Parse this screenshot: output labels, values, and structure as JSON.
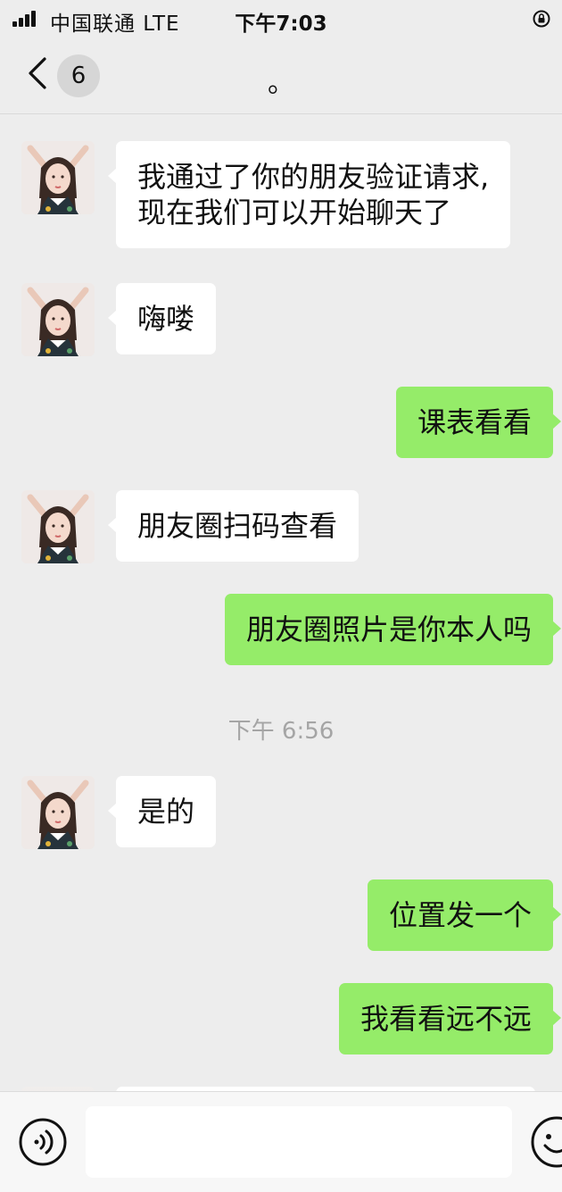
{
  "status_bar": {
    "carrier": "中国联通  LTE",
    "time": "下午7:03"
  },
  "nav": {
    "back_icon": "chevron-left-icon",
    "unread_count": "6",
    "title": "。"
  },
  "messages": [
    {
      "side": "left",
      "lines": [
        "我通过了你的朋友验证请求,",
        "现在我们可以开始聊天了"
      ]
    },
    {
      "side": "left",
      "lines": [
        "嗨喽"
      ]
    },
    {
      "side": "right",
      "lines": [
        "课表看看"
      ]
    },
    {
      "side": "left",
      "lines": [
        "朋友圈扫码查看"
      ]
    },
    {
      "side": "right",
      "lines": [
        "朋友圈照片是你本人吗"
      ]
    },
    {
      "side": "time",
      "text": "下午 6:56"
    },
    {
      "side": "left",
      "lines": [
        "是的"
      ]
    },
    {
      "side": "right",
      "lines": [
        "位置发一个"
      ]
    },
    {
      "side": "right",
      "lines": [
        "我看看远不远"
      ]
    }
  ],
  "input_bar": {
    "voice_icon": "voice-icon",
    "input_value": "",
    "emoji_icon": "emoji-icon"
  },
  "colors": {
    "background": "#ededed",
    "sent_bubble": "#95ec69",
    "received_bubble": "#ffffff",
    "time_text": "#a5a5a5"
  }
}
